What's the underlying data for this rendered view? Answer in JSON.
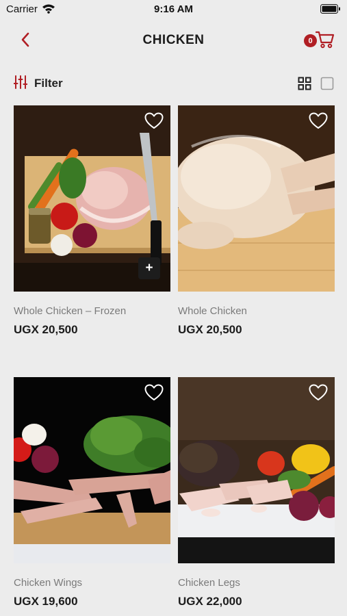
{
  "status_bar": {
    "carrier": "Carrier",
    "time": "9:16 AM"
  },
  "header": {
    "title": "CHICKEN",
    "cart_count": "0",
    "accent": "#b01e24"
  },
  "toolbar": {
    "filter_label": "Filter"
  },
  "icons": {
    "back": "chevron-left-icon",
    "cart": "shopping-cart-icon",
    "filter": "sliders-icon",
    "grid": "grid-view-icon",
    "list": "list-view-icon",
    "favorite": "heart-outline-icon",
    "add": "plus-icon"
  },
  "products": [
    {
      "name": "Whole Chicken – Frozen",
      "price": "UGX 20,500"
    },
    {
      "name": "Whole Chicken",
      "price": "UGX 20,500"
    },
    {
      "name": "Chicken Wings",
      "price": "UGX 19,600"
    },
    {
      "name": "Chicken Legs",
      "price": "UGX 22,000"
    }
  ],
  "add_button_label": "+"
}
